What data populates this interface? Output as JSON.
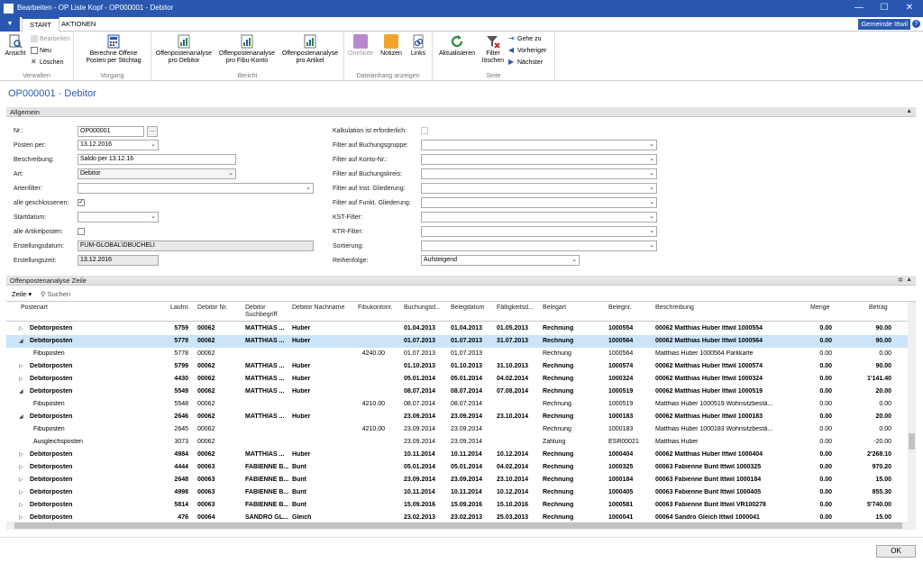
{
  "window": {
    "title": "Bearbeiten - OP Liste Kopf - OP000001 - Debitor",
    "controls": [
      "—",
      "☐",
      "✕"
    ]
  },
  "tabs": {
    "start": "START",
    "actions": "AKTIONEN"
  },
  "company": "Gemeinde Ittwil",
  "help": "?",
  "ribbon": {
    "verwalten": {
      "label": "Verwalten",
      "ansicht": "Ansicht",
      "bearbeiten": "Bearbeiten",
      "neu": "Neu",
      "loeschen": "Löschen"
    },
    "vorgang": {
      "label": "Vorgang",
      "berechne": "Berechne Offene Posten per Stichtag"
    },
    "bericht": {
      "label": "Bericht",
      "debitor": "Offenpostenanalyse pro Debitor",
      "fibu": "Offenpostenanalyse pro Fibu-Konto",
      "artikel": "Offenpostenanalyse pro Artikel"
    },
    "dateianhang": {
      "label": "Dateianhang anzeigen",
      "onenote": "OneNote",
      "notizen": "Notizen",
      "links": "Links"
    },
    "seite": {
      "label": "Seite",
      "aktualisieren": "Aktualisieren",
      "filter": "Filter löschen",
      "gehezu": "Gehe zu",
      "vorheriger": "Vorheriger",
      "naechster": "Nächster"
    },
    "colors": {
      "blue": "#2a58b0",
      "green": "#2e8b3d",
      "orange": "#f0a42b",
      "purple": "#7a2fa0",
      "red": "#c03030"
    }
  },
  "page_title": "OP000001 · Debitor",
  "allgemein": {
    "header": "Allgemein",
    "nr": {
      "label": "Nr.:",
      "value": "OP000001"
    },
    "posten_per": {
      "label": "Posten per:",
      "value": "13.12.2016"
    },
    "beschreibung": {
      "label": "Beschreibung:",
      "value": "Saldo per 13.12.16"
    },
    "art": {
      "label": "Art:",
      "value": "Debitor"
    },
    "artenfilter": {
      "label": "Artenfilter:",
      "value": ""
    },
    "alle_geschlossenen": {
      "label": "alle geschlossenen:",
      "checked": "✓"
    },
    "startdatum": {
      "label": "Startdatum:",
      "value": ""
    },
    "alle_artikelposten": {
      "label": "alle Artikelposten:",
      "checked": ""
    },
    "erstellungsdatum": {
      "label": "Erstellungsdatum:",
      "value": "FUM-GLOBAL\\DBUCHELI"
    },
    "erstellungszeit": {
      "label": "Erstellungszeit:",
      "value": "13.12.2016"
    },
    "kalkulation": {
      "label": "Kalkulation ist erforderlich:"
    },
    "filter_buchungsgruppe": {
      "label": "Filter auf Buchungsgruppe:",
      "value": ""
    },
    "filter_konto": {
      "label": "Filter auf Konto-Nr.:",
      "value": ""
    },
    "filter_buchungskreis": {
      "label": "Filter auf Buchungskreis:",
      "value": ""
    },
    "filter_inst": {
      "label": "Filter auf Inst. Gliederung:",
      "value": ""
    },
    "filter_funkt": {
      "label": "Filter auf Funkt. Gliederung:",
      "value": ""
    },
    "kst": {
      "label": "KST-Filter:",
      "value": ""
    },
    "ktr": {
      "label": "KTR-Filter:",
      "value": ""
    },
    "sortierung": {
      "label": "Sortierung:",
      "value": ""
    },
    "reihenfolge": {
      "label": "Reihenfolge:",
      "value": "Aufsteigend"
    }
  },
  "zeile": {
    "header": "Offenpostenanalyse Zeile",
    "toolbar": {
      "zeile": "Zeile",
      "suchen": "Suchen"
    },
    "columns": {
      "postenart": "Postenart",
      "laufnr": "Laufnr.",
      "debitor_nr": "Debitor Nr.",
      "suchbegriff": "Debitor Suchbegriff",
      "nachname": "Debitor Nachname",
      "fibukonto": "Fibukontonr.",
      "buchungsdatum": "Buchungsd...",
      "belegdatum": "Belegdatum",
      "faelligkeit": "Fälligkeitsd...",
      "belegart": "Belegart",
      "belegnr": "Belegnr.",
      "beschreibung": "Beschreibung",
      "menge": "Menge",
      "betrag": "Betrag"
    },
    "rows": [
      {
        "exp": "▷",
        "postenart": "Debitorposten",
        "laufnr": "5759",
        "debnr": "00062",
        "such": "MATTHIAS ...",
        "name": "Huber",
        "fibu": "",
        "bd": "01.04.2013",
        "beleg": "01.04.2013",
        "faell": "01.05.2013",
        "art": "Rechnung",
        "nr": "1000554",
        "besch": "00062 Matthias Huber Ittwil 1000554",
        "menge": "0.00",
        "betrag": "90.00"
      },
      {
        "exp": "◢",
        "postenart": "Debitorposten",
        "laufnr": "5779",
        "debnr": "00062",
        "such": "MATTHIAS ...",
        "name": "Huber",
        "fibu": "",
        "bd": "01.07.2013",
        "beleg": "01.07.2013",
        "faell": "31.07.2013",
        "art": "Rechnung",
        "nr": "1000564",
        "besch": "00062 Matthias Huber Ittwil 1000564",
        "menge": "0.00",
        "betrag": "90.00"
      },
      {
        "exp": "",
        "postenart": "Fibuposten",
        "laufnr": "5778",
        "debnr": "00062",
        "such": "",
        "name": "",
        "fibu": "4240.00",
        "bd": "01.07.2013",
        "beleg": "01.07.2013",
        "faell": "",
        "art": "Rechnung",
        "nr": "1000564",
        "besch": "Matthias Huber 1000564 Parkkarte",
        "menge": "0.00",
        "betrag": "0.00"
      },
      {
        "exp": "▷",
        "postenart": "Debitorposten",
        "laufnr": "5799",
        "debnr": "00062",
        "such": "MATTHIAS ...",
        "name": "Huber",
        "fibu": "",
        "bd": "01.10.2013",
        "beleg": "01.10.2013",
        "faell": "31.10.2013",
        "art": "Rechnung",
        "nr": "1000574",
        "besch": "00062 Matthias Huber Ittwil 1000574",
        "menge": "0.00",
        "betrag": "90.00"
      },
      {
        "exp": "▷",
        "postenart": "Debitorposten",
        "laufnr": "4430",
        "debnr": "00062",
        "such": "MATTHIAS ...",
        "name": "Huber",
        "fibu": "",
        "bd": "05.01.2014",
        "beleg": "05.01.2014",
        "faell": "04.02.2014",
        "art": "Rechnung",
        "nr": "1000324",
        "besch": "00062 Matthias Huber Ittwil 1000324",
        "menge": "0.00",
        "betrag": "1'141.40"
      },
      {
        "exp": "◢",
        "postenart": "Debitorposten",
        "laufnr": "5549",
        "debnr": "00062",
        "such": "MATTHIAS ...",
        "name": "Huber",
        "fibu": "",
        "bd": "08.07.2014",
        "beleg": "08.07.2014",
        "faell": "07.08.2014",
        "art": "Rechnung",
        "nr": "1000519",
        "besch": "00062 Matthias Huber Ittwil 1000519",
        "menge": "0.00",
        "betrag": "20.00"
      },
      {
        "exp": "",
        "postenart": "Fibuposten",
        "laufnr": "5548",
        "debnr": "00062",
        "such": "",
        "name": "",
        "fibu": "4210.00",
        "bd": "08.07.2014",
        "beleg": "08.07.2014",
        "faell": "",
        "art": "Rechnung",
        "nr": "1000519",
        "besch": "Matthias Huber 1000519 Wohnsitzbestä...",
        "menge": "0.00",
        "betrag": "0.00"
      },
      {
        "exp": "◢",
        "postenart": "Debitorposten",
        "laufnr": "2646",
        "debnr": "00062",
        "such": "MATTHIAS ...",
        "name": "Huber",
        "fibu": "",
        "bd": "23.09.2014",
        "beleg": "23.09.2014",
        "faell": "23.10.2014",
        "art": "Rechnung",
        "nr": "1000183",
        "besch": "00062 Matthias Huber Ittwil 1000183",
        "menge": "0.00",
        "betrag": "20.00"
      },
      {
        "exp": "",
        "postenart": "Fibuposten",
        "laufnr": "2645",
        "debnr": "00062",
        "such": "",
        "name": "",
        "fibu": "4210.00",
        "bd": "23.09.2014",
        "beleg": "23.09.2014",
        "faell": "",
        "art": "Rechnung",
        "nr": "1000183",
        "besch": "Matthias Huber 1000183 Wohnsitzbestä...",
        "menge": "0.00",
        "betrag": "0.00"
      },
      {
        "exp": "",
        "postenart": "Ausgleichsposten",
        "laufnr": "3073",
        "debnr": "00062",
        "such": "",
        "name": "",
        "fibu": "",
        "bd": "23.09.2014",
        "beleg": "23.09.2014",
        "faell": "",
        "art": "Zahlung",
        "nr": "ESR00021",
        "besch": "Matthias Huber",
        "menge": "0.00",
        "betrag": "-20.00"
      },
      {
        "exp": "▷",
        "postenart": "Debitorposten",
        "laufnr": "4984",
        "debnr": "00062",
        "such": "MATTHIAS ...",
        "name": "Huber",
        "fibu": "",
        "bd": "10.11.2014",
        "beleg": "10.11.2014",
        "faell": "10.12.2014",
        "art": "Rechnung",
        "nr": "1000404",
        "besch": "00062 Matthias Huber Ittwil 1000404",
        "menge": "0.00",
        "betrag": "2'268.10"
      },
      {
        "exp": "▷",
        "postenart": "Debitorposten",
        "laufnr": "4444",
        "debnr": "00063",
        "such": "FABIENNE B...",
        "name": "Bunt",
        "fibu": "",
        "bd": "05.01.2014",
        "beleg": "05.01.2014",
        "faell": "04.02.2014",
        "art": "Rechnung",
        "nr": "1000325",
        "besch": "00063 Fabienne Bunt Ittwil 1000325",
        "menge": "0.00",
        "betrag": "970.20"
      },
      {
        "exp": "▷",
        "postenart": "Debitorposten",
        "laufnr": "2648",
        "debnr": "00063",
        "such": "FABIENNE B...",
        "name": "Bunt",
        "fibu": "",
        "bd": "23.09.2014",
        "beleg": "23.09.2014",
        "faell": "23.10.2014",
        "art": "Rechnung",
        "nr": "1000184",
        "besch": "00063 Fabienne Bunt Ittwil 1000184",
        "menge": "0.00",
        "betrag": "15.00"
      },
      {
        "exp": "▷",
        "postenart": "Debitorposten",
        "laufnr": "4998",
        "debnr": "00063",
        "such": "FABIENNE B...",
        "name": "Bunt",
        "fibu": "",
        "bd": "10.11.2014",
        "beleg": "10.11.2014",
        "faell": "10.12.2014",
        "art": "Rechnung",
        "nr": "1000405",
        "besch": "00063 Fabienne Bunt Ittwil 1000405",
        "menge": "0.00",
        "betrag": "855.30"
      },
      {
        "exp": "▷",
        "postenart": "Debitorposten",
        "laufnr": "5814",
        "debnr": "00063",
        "such": "FABIENNE B...",
        "name": "Bunt",
        "fibu": "",
        "bd": "15.09.2016",
        "beleg": "15.09.2016",
        "faell": "15.10.2016",
        "art": "Rechnung",
        "nr": "1000581",
        "besch": "00063 Fabienne Bunt Ittwil VR100278",
        "menge": "0.00",
        "betrag": "5'740.00"
      },
      {
        "exp": "▷",
        "postenart": "Debitorposten",
        "laufnr": "476",
        "debnr": "00064",
        "such": "SANDRO GL...",
        "name": "Gleich",
        "fibu": "",
        "bd": "23.02.2013",
        "beleg": "23.02.2013",
        "faell": "25.03.2013",
        "art": "Rechnung",
        "nr": "1000041",
        "besch": "00064 Sandro Gleich Ittwil 1000041",
        "menge": "0.00",
        "betrag": "15.00"
      }
    ]
  },
  "ok": "OK"
}
